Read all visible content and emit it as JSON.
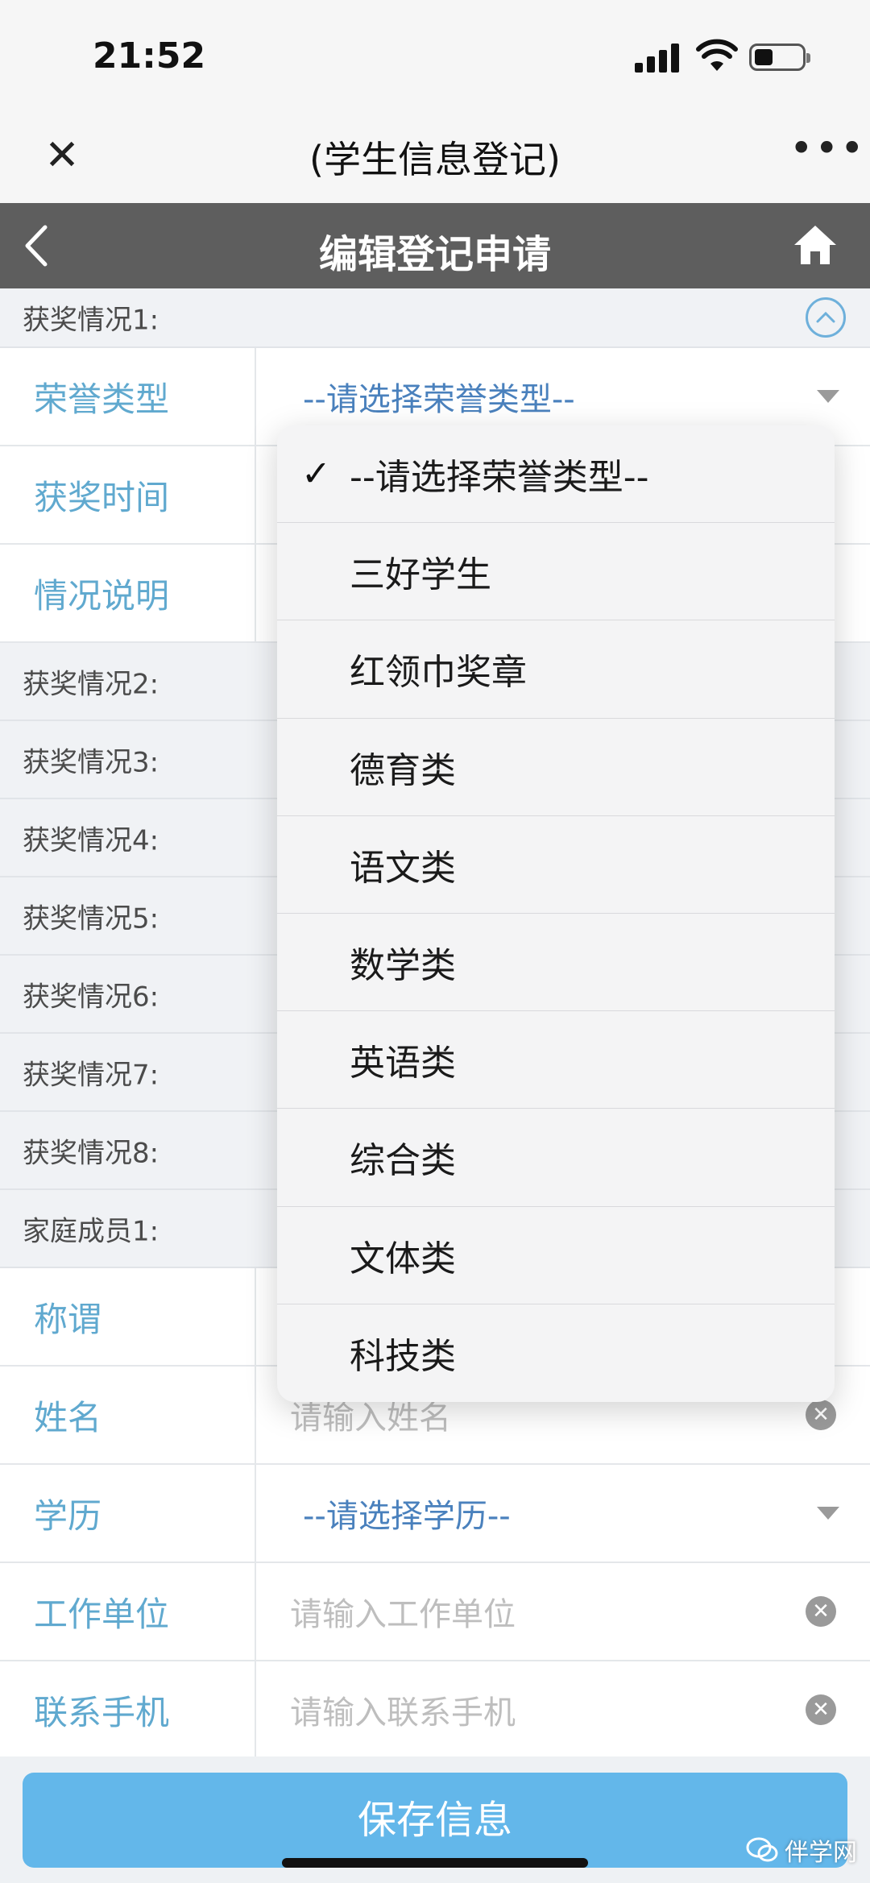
{
  "status_bar": {
    "time": "21:52"
  },
  "webview": {
    "title": "(学生信息登记)"
  },
  "nav": {
    "title": "编辑登记申请"
  },
  "award1": {
    "section": "获奖情况1:",
    "fields": [
      {
        "label": "荣誉类型",
        "value": "--请选择荣誉类型--"
      },
      {
        "label": "获奖时间",
        "value": ""
      },
      {
        "label": "情况说明",
        "value": ""
      }
    ]
  },
  "sections": [
    "获奖情况2:",
    "获奖情况3:",
    "获奖情况4:",
    "获奖情况5:",
    "获奖情况6:",
    "获奖情况7:",
    "获奖情况8:",
    "家庭成员1:"
  ],
  "family": {
    "fields": [
      {
        "label": "称谓",
        "value": ""
      },
      {
        "label": "姓名",
        "placeholder": "请输入姓名"
      },
      {
        "label": "学历",
        "value": "--请选择学历--"
      },
      {
        "label": "工作单位",
        "placeholder": "请输入工作单位"
      },
      {
        "label": "联系手机",
        "placeholder": "请输入联系手机"
      }
    ]
  },
  "save": {
    "label": "保存信息"
  },
  "watermark": {
    "text": "伴学网"
  },
  "picker": {
    "selected_index": 0,
    "options": [
      "--请选择荣誉类型--",
      "三好学生",
      "红领巾奖章",
      "德育类",
      "语文类",
      "数学类",
      "英语类",
      "综合类",
      "文体类",
      "科技类"
    ]
  },
  "colors": {
    "nav_bg": "#5e5e5e",
    "label_blue": "#4a9ec9",
    "select_blue": "#3270b4",
    "save_bg": "#63b7ea"
  }
}
